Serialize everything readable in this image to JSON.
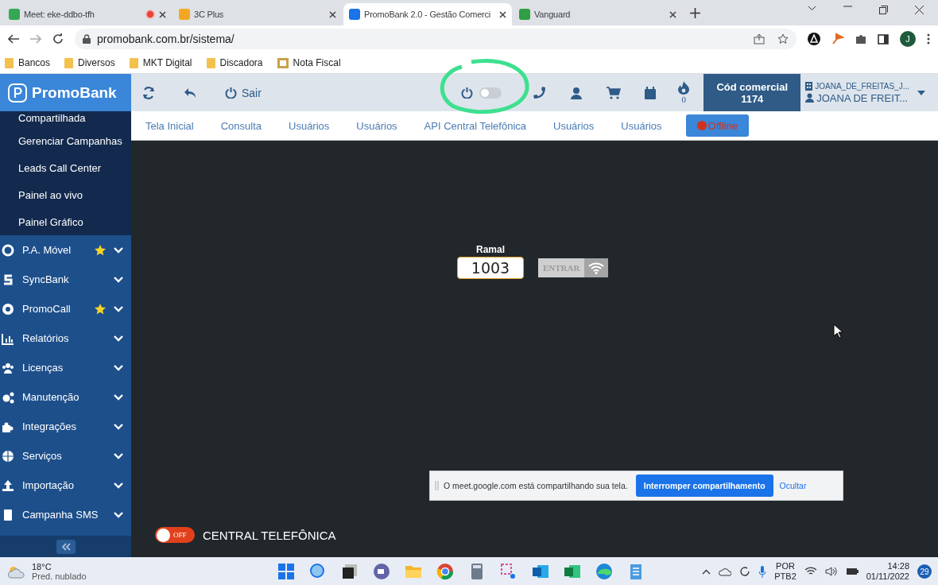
{
  "browser": {
    "tabs": [
      {
        "title": "Meet: eke-ddbo-tfh",
        "selected": false,
        "recording": true
      },
      {
        "title": "3C Plus",
        "selected": false,
        "recording": false
      },
      {
        "title": "PromoBank 2.0 - Gestão Comerci",
        "selected": true,
        "recording": false
      },
      {
        "title": "Vanguard",
        "selected": false,
        "recording": false
      }
    ],
    "address": "promobank.com.br/sistema/",
    "profile_initial": "J",
    "bookmarks": [
      "Bancos",
      "Diversos",
      "MKT Digital",
      "Discadora",
      "Nota Fiscal"
    ]
  },
  "app": {
    "logo": "PromoBank",
    "exit_label": "Sair",
    "power_on": false,
    "flame_count": "0",
    "code_label": "Cód comercial",
    "code_value": "1174",
    "user_company": "JOANA_DE_FREITAS_J...",
    "user_name": "JOANA DE FREIT...",
    "nav_tabs": [
      "Tela Inicial",
      "Consulta",
      "Usuários",
      "Usuários",
      "API Central Telefônica",
      "Usuários",
      "Usuários"
    ],
    "status": {
      "label": "Offline",
      "color": "#d0321f"
    },
    "sidebar": {
      "submenu": [
        "Compartilhada",
        "Gerenciar Campanhas",
        "Leads Call Center",
        "Painel ao vivo",
        "Painel Gráfico"
      ],
      "items": [
        {
          "label": "P.A. Móvel",
          "starred": true
        },
        {
          "label": "SyncBank",
          "starred": false
        },
        {
          "label": "PromoCall",
          "starred": true
        },
        {
          "label": "Relatórios",
          "starred": false
        },
        {
          "label": "Licenças",
          "starred": false
        },
        {
          "label": "Manutenção",
          "starred": false
        },
        {
          "label": "Integrações",
          "starred": false
        },
        {
          "label": "Serviços",
          "starred": false
        },
        {
          "label": "Importação",
          "starred": false
        },
        {
          "label": "Campanha SMS",
          "starred": false
        }
      ]
    },
    "extension": {
      "label": "Ramal",
      "value": "1003",
      "button": "ENTRAR"
    },
    "central": {
      "on": false,
      "state_label": "OFF",
      "title": "CENTRAL TELEFÔNICA"
    }
  },
  "share_bar": {
    "message": "O meet.google.com está compartilhando sua tela.",
    "stop_button": "Interromper compartilhamento",
    "hide_link": "Ocultar"
  },
  "taskbar": {
    "temperature": "18°C",
    "weather": "Pred. nublado",
    "language": "POR",
    "layout": "PTB2",
    "time": "14:28",
    "date": "01/11/2022",
    "notifications": "29"
  }
}
